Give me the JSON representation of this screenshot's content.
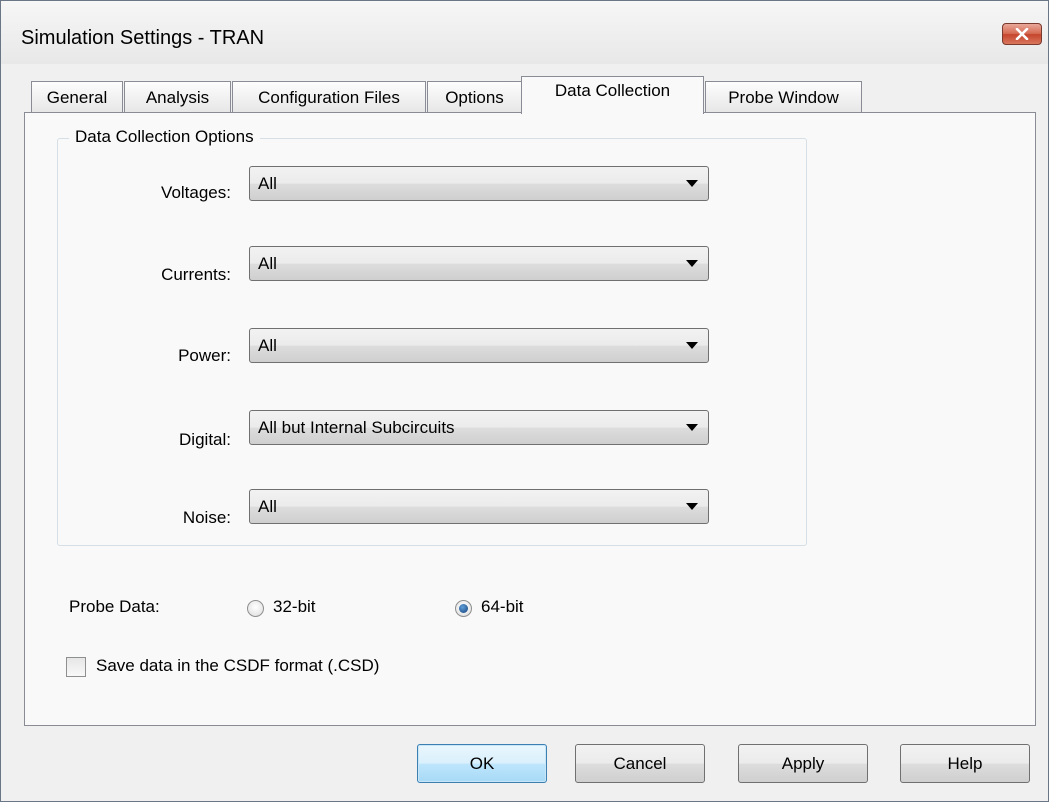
{
  "window": {
    "title": "Simulation Settings - TRAN",
    "close_icon": "close-icon"
  },
  "tabs": [
    {
      "label": "General",
      "active": false
    },
    {
      "label": "Analysis",
      "active": false
    },
    {
      "label": "Configuration Files",
      "active": false
    },
    {
      "label": "Options",
      "active": false
    },
    {
      "label": "Data Collection",
      "active": true
    },
    {
      "label": "Probe Window",
      "active": false
    }
  ],
  "data_collection": {
    "group_title": "Data Collection Options",
    "rows": [
      {
        "label": "Voltages:",
        "value": "All"
      },
      {
        "label": "Currents:",
        "value": "All"
      },
      {
        "label": "Power:",
        "value": "All"
      },
      {
        "label": "Digital:",
        "value": "All but Internal Subcircuits"
      },
      {
        "label": "Noise:",
        "value": "All"
      }
    ]
  },
  "probe_data": {
    "label": "Probe Data:",
    "options": [
      {
        "label": "32-bit",
        "selected": false
      },
      {
        "label": "64-bit",
        "selected": true
      }
    ]
  },
  "save_csdf": {
    "label": "Save data in the CSDF format (.CSD)",
    "checked": false
  },
  "buttons": {
    "ok": "OK",
    "cancel": "Cancel",
    "apply": "Apply",
    "help": "Help"
  },
  "colors": {
    "close_button": "#c5452c",
    "default_button_border": "#3c7fb1",
    "radio_selected": "#14417c"
  }
}
